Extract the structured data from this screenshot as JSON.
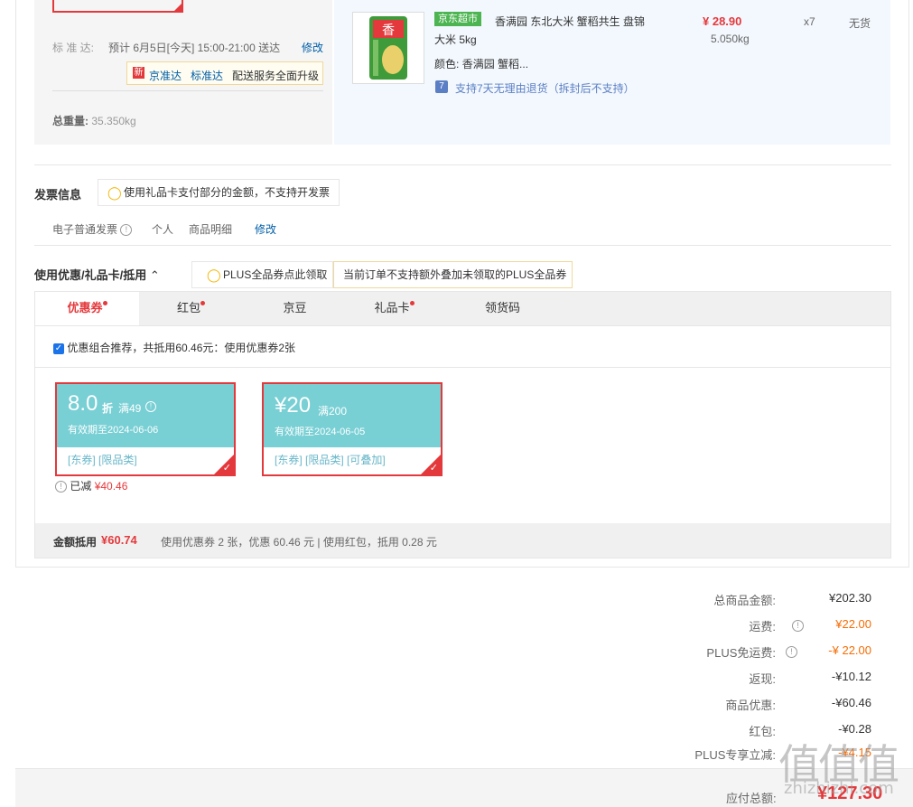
{
  "shipping": {
    "top_cut_text": "",
    "standard_label": "标 准 达:",
    "standard_text": "预计 6月5日[今天] 15:00-21:00 送达",
    "modify_label": "修改",
    "promo_badge": "新",
    "promo_jzd": "京准达",
    "promo_bzd": "标准达",
    "promo_text": "配送服务全面升级",
    "weight_label": "总重量:",
    "weight_value": "35.350kg"
  },
  "item": {
    "store_tag": "京东超市",
    "title_line1": "香满园 东北大米 蟹稻共生 盘锦",
    "title_line2": "大米 5kg",
    "color_label": "颜色:",
    "color_value": "香满园 蟹稻...",
    "return_icon": "7",
    "return_text": "支持7天无理由退货（拆封后不支持）",
    "price": "¥ 28.90",
    "weight": "5.050kg",
    "qty": "x7",
    "stock": "无货"
  },
  "invoice": {
    "title": "发票信息",
    "tip": "使用礼品卡支付部分的金额，不支持开发票",
    "type": "电子普通发票",
    "person": "个人",
    "detail": "商品明细",
    "modify": "修改"
  },
  "discount": {
    "title": "使用优惠/礼品卡/抵用",
    "plus_tip": "PLUS全品券点此领取",
    "plus_notice": "当前订单不支持额外叠加未领取的PLUS全品券",
    "tabs": [
      {
        "label": "优惠券",
        "dot": true
      },
      {
        "label": "红包",
        "dot": true
      },
      {
        "label": "京豆",
        "dot": false
      },
      {
        "label": "礼品卡",
        "dot": true
      },
      {
        "label": "领货码",
        "dot": false
      }
    ],
    "combo_text": "优惠组合推荐，共抵用60.46元：使用优惠券2张",
    "coupons": [
      {
        "amount": "8.0",
        "unit": "折",
        "cond": "满49",
        "valid": "有效期至2024-06-06",
        "tags": "[东券]  [限品类]"
      },
      {
        "amount": "¥20",
        "unit": "",
        "cond": "满200",
        "valid": "有效期至2024-06-05",
        "tags": "[东券]  [限品类]  [可叠加]"
      }
    ],
    "reduced_label": "已减",
    "reduced_value": "¥40.46",
    "summary_label": "金额抵用",
    "summary_value": "¥60.74",
    "summary_detail": "使用优惠券 2 张，优惠 60.46 元  | 使用红包，抵用 0.28 元"
  },
  "totals": {
    "rows": [
      {
        "label": "总商品金额:",
        "value": "¥202.30"
      },
      {
        "label": "运费:",
        "value": "¥22.00"
      },
      {
        "label": "PLUS免运费:",
        "value": "-¥ 22.00"
      },
      {
        "label": "返现:",
        "value": "-¥10.12"
      },
      {
        "label": "商品优惠:",
        "value": "-¥60.46"
      },
      {
        "label": "红包:",
        "value": "-¥0.28"
      },
      {
        "label": "PLUS专享立减:",
        "value": "-¥4.15"
      }
    ],
    "payable_label": "应付总额:",
    "payable_value": "¥127.30"
  },
  "watermark": "值 值 值 zhizhizhi.com",
  "colors": {
    "red": "#e4393c",
    "teal": "#78cfd4",
    "link": "#005ea7",
    "orange": "#f66c04"
  }
}
